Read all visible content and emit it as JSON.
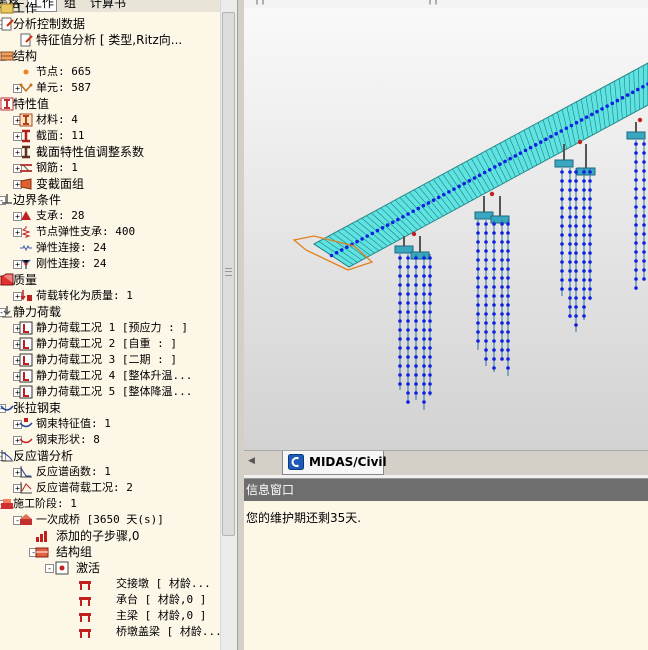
{
  "tabs": [
    "表格",
    "工作",
    "组",
    "计算书"
  ],
  "tree": [
    {
      "text": "工作",
      "level": 0,
      "exp": "",
      "icon": "folder",
      "mono": false
    },
    {
      "text": "分析控制数据",
      "level": 0,
      "exp": "-",
      "icon": "doc",
      "mono": false
    },
    {
      "text": "特征值分析 [ 类型,Ritz向...",
      "level": 1,
      "exp": "",
      "icon": "doc",
      "mono": false
    },
    {
      "text": "结构",
      "level": 0,
      "exp": "-",
      "icon": "struct",
      "mono": false
    },
    {
      "text": "节点: 665",
      "level": 1,
      "exp": "",
      "icon": "node",
      "mono": true
    },
    {
      "text": "单元: 587",
      "level": 1,
      "exp": "+",
      "icon": "elem",
      "mono": true
    },
    {
      "text": "特性值",
      "level": 0,
      "exp": "-",
      "icon": "prop",
      "mono": false
    },
    {
      "text": "材料: 4",
      "level": 1,
      "exp": "+",
      "icon": "mat",
      "mono": true
    },
    {
      "text": "截面: 11",
      "level": 1,
      "exp": "+",
      "icon": "ibeam",
      "mono": true
    },
    {
      "text": "截面特性值调整系数",
      "level": 1,
      "exp": "+",
      "icon": "ibeam2",
      "mono": false
    },
    {
      "text": "钢筋: 1",
      "level": 1,
      "exp": "+",
      "icon": "rebar",
      "mono": true
    },
    {
      "text": "变截面组",
      "level": 1,
      "exp": "+",
      "icon": "taper",
      "mono": false
    },
    {
      "text": "边界条件",
      "level": 0,
      "exp": "-",
      "icon": "bound",
      "mono": false
    },
    {
      "text": "支承: 28",
      "level": 1,
      "exp": "+",
      "icon": "support",
      "mono": true
    },
    {
      "text": "节点弹性支承: 400",
      "level": 1,
      "exp": "+",
      "icon": "spring",
      "mono": true
    },
    {
      "text": "弹性连接: 24",
      "level": 1,
      "exp": "",
      "icon": "elink",
      "mono": true
    },
    {
      "text": "刚性连接: 24",
      "level": 1,
      "exp": "+",
      "icon": "rlink",
      "mono": true
    },
    {
      "text": "质量",
      "level": 0,
      "exp": "-",
      "icon": "mass",
      "mono": false
    },
    {
      "text": "荷载转化为质量: 1",
      "level": 1,
      "exp": "+",
      "icon": "l2m",
      "mono": true
    },
    {
      "text": "静力荷载",
      "level": 0,
      "exp": "-",
      "icon": "load",
      "mono": false
    },
    {
      "text": "静力荷载工况 1 [预应力 : ]",
      "level": 1,
      "exp": "+",
      "icon": "lc",
      "mono": true
    },
    {
      "text": "静力荷载工况 2 [自重 : ]",
      "level": 1,
      "exp": "+",
      "icon": "lc",
      "mono": true
    },
    {
      "text": "静力荷载工况 3 [二期 : ]",
      "level": 1,
      "exp": "+",
      "icon": "lc",
      "mono": true
    },
    {
      "text": "静力荷载工况 4 [整体升温...",
      "level": 1,
      "exp": "+",
      "icon": "lc",
      "mono": true
    },
    {
      "text": "静力荷载工况 5 [整体降温...",
      "level": 1,
      "exp": "+",
      "icon": "lc",
      "mono": true
    },
    {
      "text": "张拉钢束",
      "level": 0,
      "exp": "-",
      "icon": "tendon",
      "mono": false
    },
    {
      "text": "钢束特征值: 1",
      "level": 1,
      "exp": "+",
      "icon": "tprop",
      "mono": true
    },
    {
      "text": "钢束形状: 8",
      "level": 1,
      "exp": "+",
      "icon": "tshape",
      "mono": true
    },
    {
      "text": "反应谱分析",
      "level": 0,
      "exp": "-",
      "icon": "rs",
      "mono": false
    },
    {
      "text": "反应谱函数: 1",
      "level": 1,
      "exp": "+",
      "icon": "rsf",
      "mono": true
    },
    {
      "text": "反应谱荷载工况: 2",
      "level": 1,
      "exp": "+",
      "icon": "rsl",
      "mono": true
    },
    {
      "text": "施工阶段: 1",
      "level": 0,
      "exp": "-",
      "icon": "cs",
      "mono": true
    },
    {
      "text": "一次成桥 [3650 天(s)]",
      "level": 1,
      "exp": "-",
      "icon": "csstage",
      "mono": true
    },
    {
      "text": "添加的子步骤,0",
      "level": 2,
      "exp": "",
      "icon": "bars",
      "mono": false
    },
    {
      "text": "结构组",
      "level": 2,
      "exp": "-",
      "icon": "sgroup",
      "mono": false
    },
    {
      "text": "激活",
      "level": 3,
      "exp": "-",
      "icon": "activate",
      "mono": false
    },
    {
      "text": "交接墩 [ 材龄...",
      "level": 4,
      "exp": "",
      "icon": "bridge",
      "mono": true
    },
    {
      "text": "承台 [ 材龄,0 ]",
      "level": 4,
      "exp": "",
      "icon": "bridge",
      "mono": true
    },
    {
      "text": "主梁 [ 材龄,0 ]",
      "level": 4,
      "exp": "",
      "icon": "bridge",
      "mono": true
    },
    {
      "text": "桥墩盖梁 [ 材龄...",
      "level": 4,
      "exp": "",
      "icon": "bridge",
      "mono": true
    }
  ],
  "topbar_text": "┬┬",
  "doc_tab": {
    "label": "MIDAS/Civil",
    "nav": "◀"
  },
  "message_window": {
    "title": "信息窗口",
    "text": "您的维护期还剩35天."
  },
  "colors": {
    "deck": "#5fe3e0",
    "node": "#1020e0",
    "pier": "#3aa7c0",
    "panel_bg": "#fdf7e8",
    "title_bg": "#6e6e6e"
  }
}
